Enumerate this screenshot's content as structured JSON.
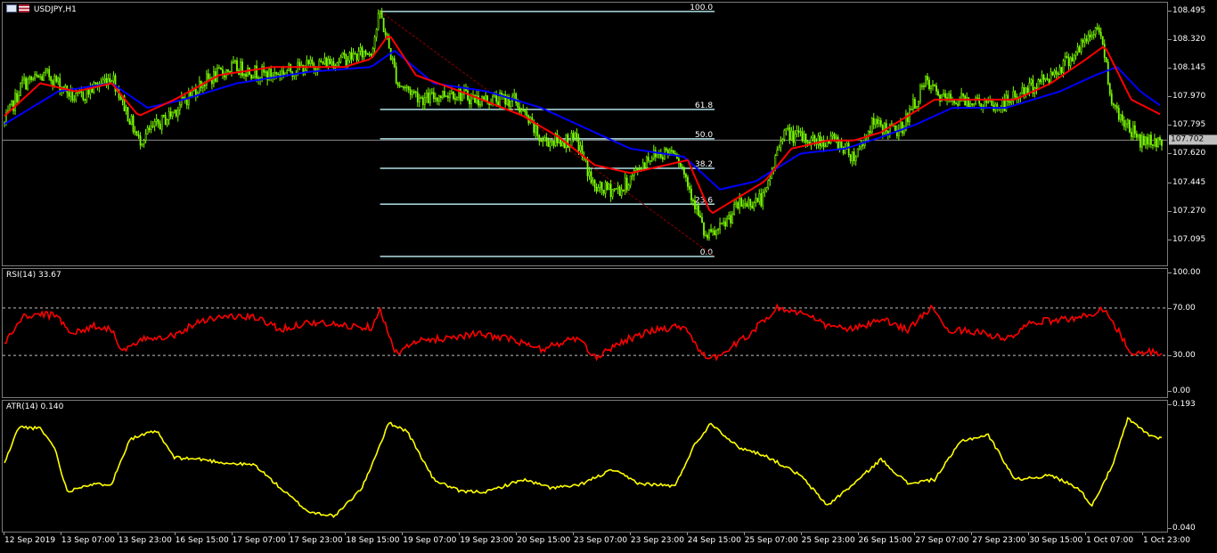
{
  "window": {
    "symbol_title": "USDJPY,H1",
    "rsi_title": "RSI(14) 33.67",
    "atr_title": "ATR(14) 0.140"
  },
  "colors": {
    "background": "#000000",
    "bull_candle": "#7CFC00",
    "bear_candle": "#7CFC00",
    "fast_ma": "#ff0000",
    "slow_ma": "#0000ff",
    "rsi": "#ff0000",
    "atr": "#ffff00",
    "fib": "#b0e0e6",
    "fib_trend": "#8b0000",
    "grid": "#7a7a7a"
  },
  "price_axis": {
    "labels": [
      "108.495",
      "108.320",
      "108.145",
      "107.970",
      "107.795",
      "107.620",
      "107.445",
      "107.270",
      "107.095"
    ],
    "current_price": "107.702"
  },
  "rsi_axis": {
    "labels": [
      "100.00",
      "70.00",
      "30.00",
      "0.00"
    ]
  },
  "atr_axis": {
    "labels": [
      "0.193",
      "0.040"
    ]
  },
  "time_axis": {
    "labels": [
      "12 Sep 2019",
      "13 Sep 07:00",
      "13 Sep 23:00",
      "16 Sep 15:00",
      "17 Sep 07:00",
      "17 Sep 23:00",
      "18 Sep 15:00",
      "19 Sep 07:00",
      "19 Sep 23:00",
      "20 Sep 15:00",
      "23 Sep 07:00",
      "23 Sep 23:00",
      "24 Sep 15:00",
      "25 Sep 07:00",
      "25 Sep 23:00",
      "26 Sep 15:00",
      "27 Sep 07:00",
      "27 Sep 23:00",
      "30 Sep 15:00",
      "1 Oct 07:00",
      "1 Oct 23:00"
    ]
  },
  "fibonacci": {
    "levels": [
      {
        "label": "100.0",
        "price": 108.49
      },
      {
        "label": "61.8",
        "price": 107.89
      },
      {
        "label": "50.0",
        "price": 107.71
      },
      {
        "label": "38.2",
        "price": 107.53
      },
      {
        "label": "23.6",
        "price": 107.31
      },
      {
        "label": "0.0",
        "price": 106.99
      }
    ]
  },
  "chart_data": [
    {
      "type": "candlestick",
      "title": "USDJPY,H1",
      "ylim": [
        106.98,
        108.52
      ],
      "x_range": [
        "12 Sep 2019",
        "2 Oct 2019"
      ],
      "close_path": [
        [
          0,
          107.8
        ],
        [
          10,
          108.05
        ],
        [
          25,
          108.1
        ],
        [
          40,
          107.95
        ],
        [
          60,
          108.1
        ],
        [
          75,
          107.7
        ],
        [
          92,
          107.85
        ],
        [
          110,
          108.05
        ],
        [
          128,
          108.15
        ],
        [
          148,
          108.1
        ],
        [
          168,
          108.15
        ],
        [
          190,
          108.2
        ],
        [
          205,
          108.25
        ],
        [
          210,
          108.48
        ],
        [
          220,
          108.05
        ],
        [
          235,
          107.95
        ],
        [
          250,
          108.0
        ],
        [
          265,
          107.95
        ],
        [
          285,
          107.95
        ],
        [
          300,
          107.7
        ],
        [
          320,
          107.7
        ],
        [
          330,
          107.4
        ],
        [
          345,
          107.4
        ],
        [
          360,
          107.6
        ],
        [
          375,
          107.65
        ],
        [
          385,
          107.35
        ],
        [
          392,
          107.1
        ],
        [
          400,
          107.15
        ],
        [
          410,
          107.3
        ],
        [
          425,
          107.35
        ],
        [
          435,
          107.75
        ],
        [
          450,
          107.7
        ],
        [
          465,
          107.7
        ],
        [
          475,
          107.6
        ],
        [
          485,
          107.8
        ],
        [
          500,
          107.75
        ],
        [
          515,
          108.05
        ],
        [
          525,
          107.95
        ],
        [
          540,
          107.95
        ],
        [
          555,
          107.9
        ],
        [
          570,
          108.0
        ],
        [
          585,
          108.1
        ],
        [
          600,
          108.25
        ],
        [
          612,
          108.4
        ],
        [
          620,
          107.9
        ],
        [
          635,
          107.7
        ],
        [
          648,
          107.7
        ]
      ],
      "fast_ma": [
        [
          0,
          107.85
        ],
        [
          20,
          108.05
        ],
        [
          40,
          108.0
        ],
        [
          60,
          108.05
        ],
        [
          75,
          107.85
        ],
        [
          95,
          107.95
        ],
        [
          120,
          108.1
        ],
        [
          150,
          108.15
        ],
        [
          190,
          108.15
        ],
        [
          205,
          108.2
        ],
        [
          215,
          108.35
        ],
        [
          230,
          108.1
        ],
        [
          260,
          107.98
        ],
        [
          290,
          107.85
        ],
        [
          310,
          107.72
        ],
        [
          330,
          107.55
        ],
        [
          350,
          107.5
        ],
        [
          370,
          107.55
        ],
        [
          382,
          107.58
        ],
        [
          395,
          107.25
        ],
        [
          410,
          107.35
        ],
        [
          425,
          107.45
        ],
        [
          440,
          107.65
        ],
        [
          460,
          107.7
        ],
        [
          475,
          107.7
        ],
        [
          490,
          107.75
        ],
        [
          505,
          107.85
        ],
        [
          520,
          107.95
        ],
        [
          545,
          107.95
        ],
        [
          565,
          107.95
        ],
        [
          585,
          108.05
        ],
        [
          605,
          108.2
        ],
        [
          615,
          108.28
        ],
        [
          630,
          107.95
        ],
        [
          648,
          107.85
        ]
      ],
      "slow_ma": [
        [
          0,
          107.8
        ],
        [
          30,
          108.0
        ],
        [
          60,
          108.05
        ],
        [
          80,
          107.9
        ],
        [
          100,
          107.95
        ],
        [
          130,
          108.05
        ],
        [
          170,
          108.12
        ],
        [
          205,
          108.15
        ],
        [
          218,
          108.25
        ],
        [
          240,
          108.05
        ],
        [
          270,
          108.0
        ],
        [
          300,
          107.9
        ],
        [
          320,
          107.8
        ],
        [
          350,
          107.65
        ],
        [
          380,
          107.6
        ],
        [
          400,
          107.4
        ],
        [
          420,
          107.45
        ],
        [
          445,
          107.62
        ],
        [
          470,
          107.65
        ],
        [
          490,
          107.72
        ],
        [
          510,
          107.8
        ],
        [
          530,
          107.9
        ],
        [
          560,
          107.9
        ],
        [
          590,
          108.0
        ],
        [
          610,
          108.1
        ],
        [
          622,
          108.15
        ],
        [
          635,
          108.0
        ],
        [
          648,
          107.9
        ]
      ]
    },
    {
      "type": "line",
      "title": "RSI(14) 33.67",
      "ylim": [
        0,
        100
      ],
      "levels": [
        70,
        30
      ],
      "series": [
        {
          "values": [
            [
              0,
              40
            ],
            [
              10,
              62
            ],
            [
              20,
              65
            ],
            [
              30,
              63
            ],
            [
              38,
              48
            ],
            [
              50,
              55
            ],
            [
              60,
              52
            ],
            [
              66,
              33
            ],
            [
              80,
              45
            ],
            [
              95,
              47
            ],
            [
              110,
              60
            ],
            [
              125,
              63
            ],
            [
              140,
              62
            ],
            [
              155,
              52
            ],
            [
              170,
              58
            ],
            [
              190,
              55
            ],
            [
              205,
              54
            ],
            [
              210,
              70
            ],
            [
              218,
              32
            ],
            [
              232,
              42
            ],
            [
              248,
              45
            ],
            [
              262,
              48
            ],
            [
              280,
              45
            ],
            [
              300,
              35
            ],
            [
              320,
              45
            ],
            [
              330,
              28
            ],
            [
              345,
              42
            ],
            [
              365,
              52
            ],
            [
              380,
              55
            ],
            [
              393,
              25
            ],
            [
              405,
              35
            ],
            [
              418,
              50
            ],
            [
              432,
              70
            ],
            [
              445,
              66
            ],
            [
              460,
              55
            ],
            [
              475,
              52
            ],
            [
              490,
              60
            ],
            [
              505,
              52
            ],
            [
              518,
              70
            ],
            [
              526,
              52
            ],
            [
              545,
              50
            ],
            [
              560,
              43
            ],
            [
              575,
              58
            ],
            [
              590,
              60
            ],
            [
              605,
              63
            ],
            [
              615,
              70
            ],
            [
              625,
              45
            ],
            [
              630,
              30
            ],
            [
              640,
              33
            ],
            [
              648,
              32
            ]
          ]
        }
      ]
    },
    {
      "type": "line",
      "title": "ATR(14) 0.140",
      "ylim": [
        0.04,
        0.193
      ],
      "series": [
        {
          "values": [
            [
              0,
              0.12
            ],
            [
              8,
              0.165
            ],
            [
              20,
              0.163
            ],
            [
              28,
              0.14
            ],
            [
              35,
              0.085
            ],
            [
              45,
              0.093
            ],
            [
              60,
              0.095
            ],
            [
              70,
              0.15
            ],
            [
              85,
              0.16
            ],
            [
              95,
              0.127
            ],
            [
              110,
              0.125
            ],
            [
              125,
              0.12
            ],
            [
              140,
              0.118
            ],
            [
              155,
              0.088
            ],
            [
              170,
              0.06
            ],
            [
              185,
              0.055
            ],
            [
              200,
              0.09
            ],
            [
              215,
              0.17
            ],
            [
              225,
              0.16
            ],
            [
              240,
              0.1
            ],
            [
              255,
              0.085
            ],
            [
              270,
              0.085
            ],
            [
              290,
              0.1
            ],
            [
              305,
              0.09
            ],
            [
              320,
              0.092
            ],
            [
              340,
              0.112
            ],
            [
              355,
              0.095
            ],
            [
              375,
              0.092
            ],
            [
              385,
              0.14
            ],
            [
              395,
              0.17
            ],
            [
              410,
              0.14
            ],
            [
              425,
              0.13
            ],
            [
              445,
              0.105
            ],
            [
              460,
              0.068
            ],
            [
              475,
              0.095
            ],
            [
              490,
              0.125
            ],
            [
              505,
              0.095
            ],
            [
              520,
              0.1
            ],
            [
              535,
              0.148
            ],
            [
              550,
              0.155
            ],
            [
              565,
              0.1
            ],
            [
              585,
              0.105
            ],
            [
              600,
              0.09
            ],
            [
              608,
              0.068
            ],
            [
              620,
              0.12
            ],
            [
              628,
              0.175
            ],
            [
              640,
              0.155
            ],
            [
              648,
              0.15
            ]
          ]
        }
      ]
    }
  ]
}
